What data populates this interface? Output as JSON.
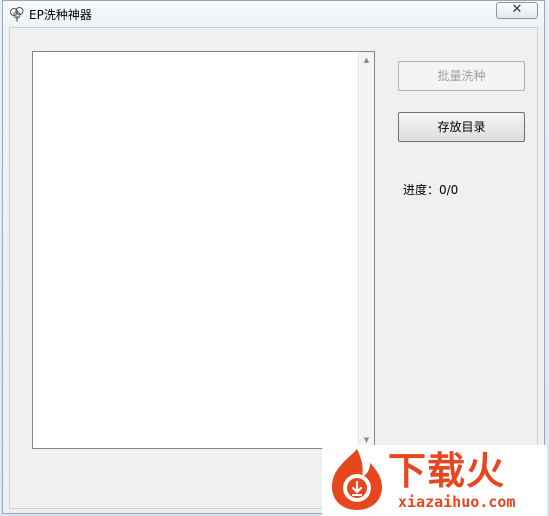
{
  "window": {
    "title": "EP洗种神器",
    "close_symbol": "✕",
    "icon": "tree-icon"
  },
  "listbox": {
    "items": [],
    "scroll_up_symbol": "▲",
    "scroll_down_symbol": "▼"
  },
  "buttons": {
    "batch_seed_label": "批量洗种",
    "batch_seed_enabled": false,
    "save_dir_label": "存放目录"
  },
  "progress": {
    "label": "进度：0/0"
  },
  "watermark": {
    "title": "下载火",
    "subtitle": "xiazaihuo.com",
    "brand_color": "#e8461e"
  }
}
